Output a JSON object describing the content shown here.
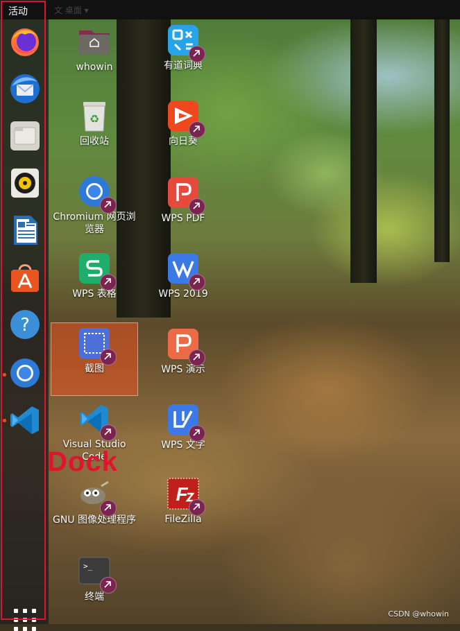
{
  "topbar": {
    "activities": "活动",
    "faint_menu": "文 桌面 ▾"
  },
  "dock": {
    "items": [
      {
        "name": "Firefox",
        "icon": "firefox-icon",
        "running": false
      },
      {
        "name": "Thunderbird",
        "icon": "thunderbird-icon",
        "running": false
      },
      {
        "name": "Files",
        "icon": "files-icon",
        "running": false
      },
      {
        "name": "Rhythmbox",
        "icon": "rhythmbox-icon",
        "running": false
      },
      {
        "name": "LibreOffice Writer",
        "icon": "writer-icon",
        "running": false
      },
      {
        "name": "Ubuntu Software",
        "icon": "software-icon",
        "running": false
      },
      {
        "name": "Help",
        "icon": "help-icon",
        "running": false
      },
      {
        "name": "Chromium",
        "icon": "chromium-icon",
        "running": true
      },
      {
        "name": "Visual Studio Code",
        "icon": "vscode-icon",
        "running": true
      }
    ],
    "show_apps": "show-applications-icon"
  },
  "annotation": "Dock",
  "desktop": {
    "left_column": [
      {
        "label": "whowin",
        "icon": "home-folder-icon",
        "shortcut": false
      },
      {
        "label": "回收站",
        "icon": "trash-icon",
        "shortcut": false
      },
      {
        "label": "Chromium 网页浏览器",
        "icon": "chromium-icon",
        "shortcut": true
      },
      {
        "label": "WPS 表格",
        "icon": "wps-spreadsheet-icon",
        "shortcut": true
      },
      {
        "label": "截图",
        "icon": "screenshot-icon",
        "shortcut": true,
        "selected": true
      },
      {
        "label": "Visual Studio Code",
        "icon": "vscode-icon",
        "shortcut": true
      },
      {
        "label": "GNU 图像处理程序",
        "icon": "gimp-icon",
        "shortcut": true
      },
      {
        "label": "终端",
        "icon": "terminal-icon",
        "shortcut": true
      }
    ],
    "right_column": [
      {
        "label": "有道词典",
        "icon": "youdao-icon",
        "shortcut": true
      },
      {
        "label": "向日葵",
        "icon": "sunlogin-icon",
        "shortcut": true
      },
      {
        "label": "WPS PDF",
        "icon": "wps-pdf-icon",
        "shortcut": true
      },
      {
        "label": "WPS 2019",
        "icon": "wps-2019-icon",
        "shortcut": true
      },
      {
        "label": "WPS 演示",
        "icon": "wps-presentation-icon",
        "shortcut": true
      },
      {
        "label": "WPS 文字",
        "icon": "wps-writer-icon",
        "shortcut": true
      },
      {
        "label": "FileZilla",
        "icon": "filezilla-icon",
        "shortcut": true
      }
    ]
  },
  "watermark": "CSDN @whowin",
  "colors": {
    "accent": "#e95420",
    "annotation_red": "#e1142d",
    "shortcut_badge": "#7a2450"
  }
}
